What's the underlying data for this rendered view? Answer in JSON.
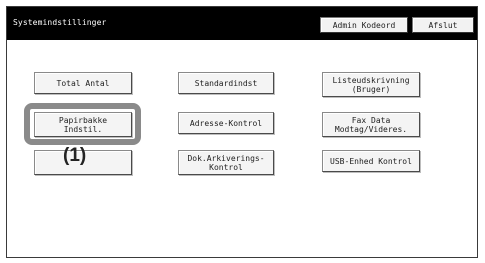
{
  "header": {
    "title": "Systemindstillinger",
    "admin_button": "Admin Kodeord",
    "exit_button": "Afslut"
  },
  "menu": {
    "total_antal": "Total Antal",
    "standardindst": "Standardindst",
    "listeudskrivning": "Listeudskrivning\n(Bruger)",
    "papirbakke": "Papirbakke\nIndstil.",
    "adresse_kontrol": "Adresse-Kontrol",
    "fax_data": "Fax Data\nModtag/Videres.",
    "blank": "",
    "dok_arkivering": "Dok.Arkiverings-\nKontrol",
    "usb_enhed": "USB-Enhed Kontrol"
  },
  "callout": {
    "label": "(1)"
  }
}
